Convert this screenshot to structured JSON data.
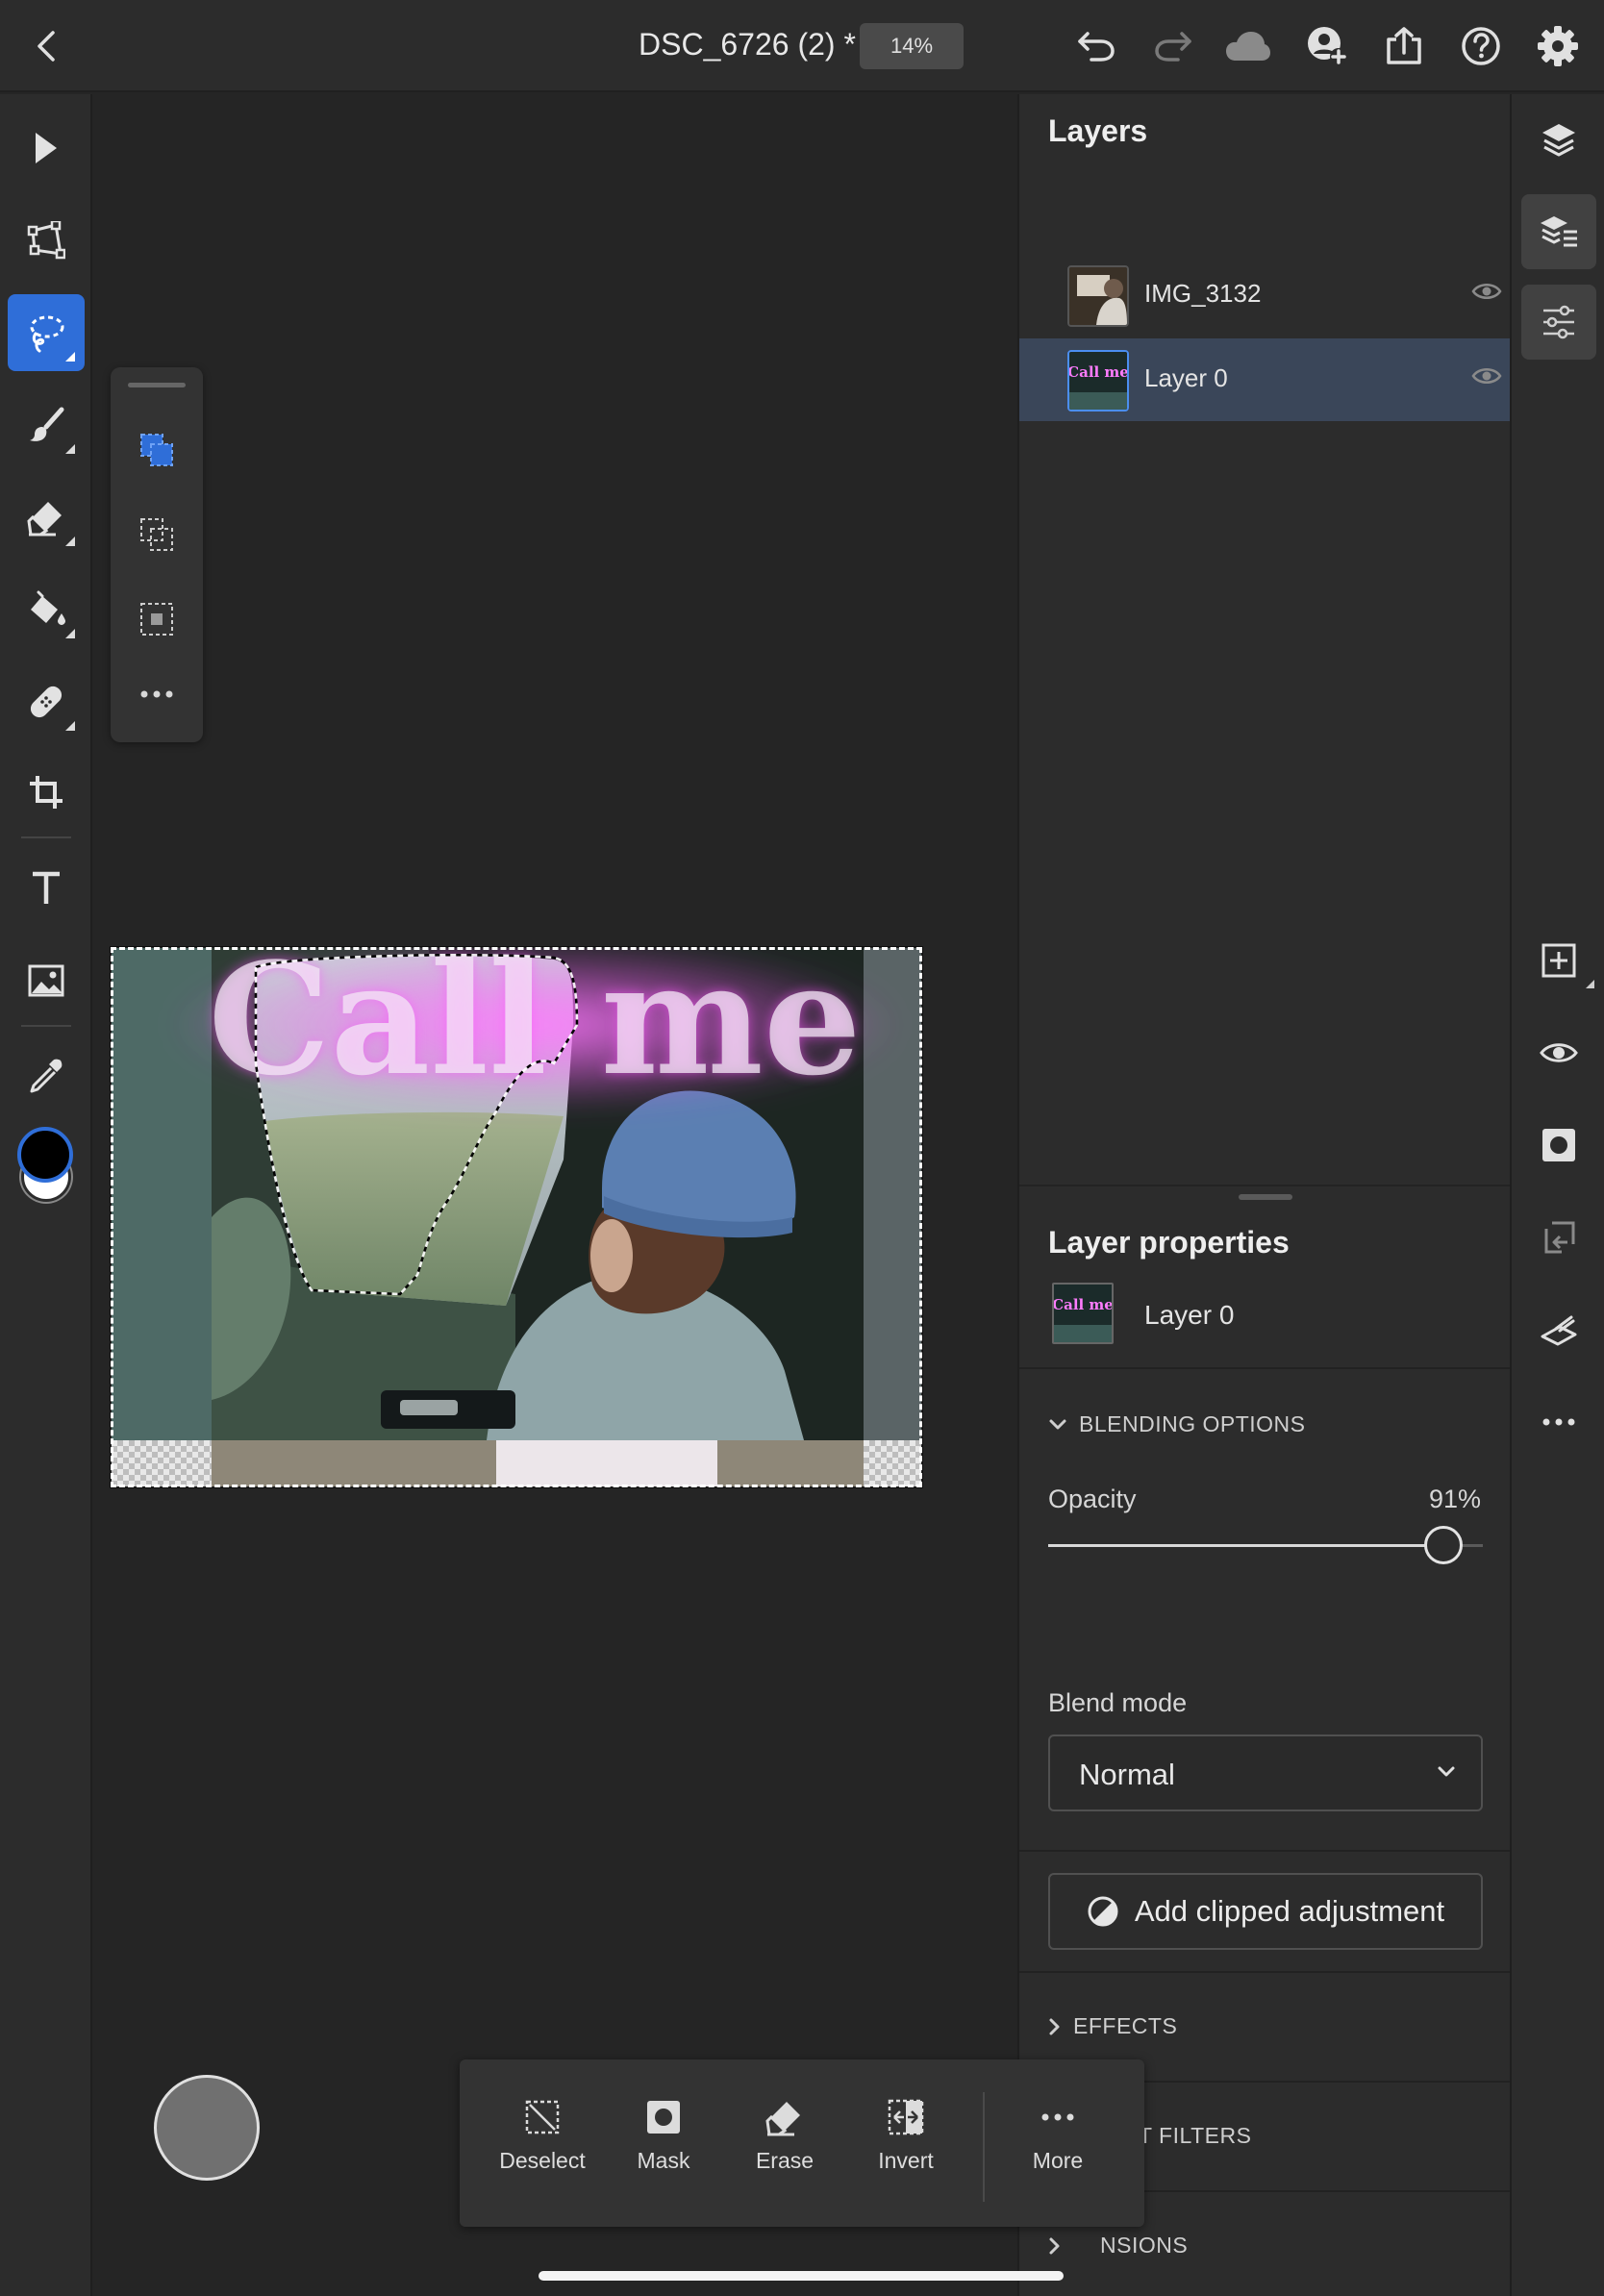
{
  "document": {
    "title": "DSC_6726 (2) *",
    "zoom": "14%"
  },
  "topbar": {
    "icons": [
      "back-icon",
      "undo-icon",
      "redo-icon",
      "cloud-icon",
      "invite-icon",
      "share-icon",
      "help-icon",
      "settings-icon"
    ]
  },
  "left_toolbar": {
    "tools": [
      "move-tool",
      "transform-tool",
      "lasso-select-tool",
      "brush-tool",
      "eraser-tool",
      "fill-tool",
      "heal-tool",
      "crop-tool",
      "type-tool",
      "place-image-tool",
      "eyedropper-tool"
    ],
    "active_tool": "lasso-select-tool",
    "colors": {
      "foreground": "#000000",
      "background": "#ffffff"
    }
  },
  "selection_modes": {
    "items": [
      "new-selection",
      "add-to-selection",
      "subtract-from-selection",
      "more"
    ]
  },
  "canvas": {
    "artwork_text": "Call me"
  },
  "layers": {
    "title": "Layers",
    "items": [
      {
        "name": "IMG_3132",
        "visible": true,
        "selected": false
      },
      {
        "name": "Layer 0",
        "visible": true,
        "selected": true
      }
    ]
  },
  "layer_properties": {
    "title": "Layer properties",
    "layer_name": "Layer 0",
    "thumb_text": "Call me",
    "blending_options_label": "BLENDING OPTIONS",
    "opacity_label": "Opacity",
    "opacity_value": "91%",
    "opacity": 0.91,
    "blend_mode_label": "Blend mode",
    "blend_mode": "Normal",
    "add_clipped_adjustment": "Add clipped adjustment",
    "effects_label": "EFFECTS",
    "smart_filters_label": "SMART FILTERS",
    "extensions_label": "NSIONS"
  },
  "icon_rail": {
    "icons": [
      "layers-icon",
      "layer-properties-icon",
      "adjustments-icon",
      "add-layer-icon",
      "visibility-icon",
      "mask-icon",
      "clip-icon",
      "flatten-icon",
      "more-icon"
    ]
  },
  "action_bar": {
    "deselect": "Deselect",
    "mask": "Mask",
    "erase": "Erase",
    "invert": "Invert",
    "more": "More"
  },
  "colors": {
    "accent": "#2f6ed8",
    "selected_row": "#3a4659"
  }
}
